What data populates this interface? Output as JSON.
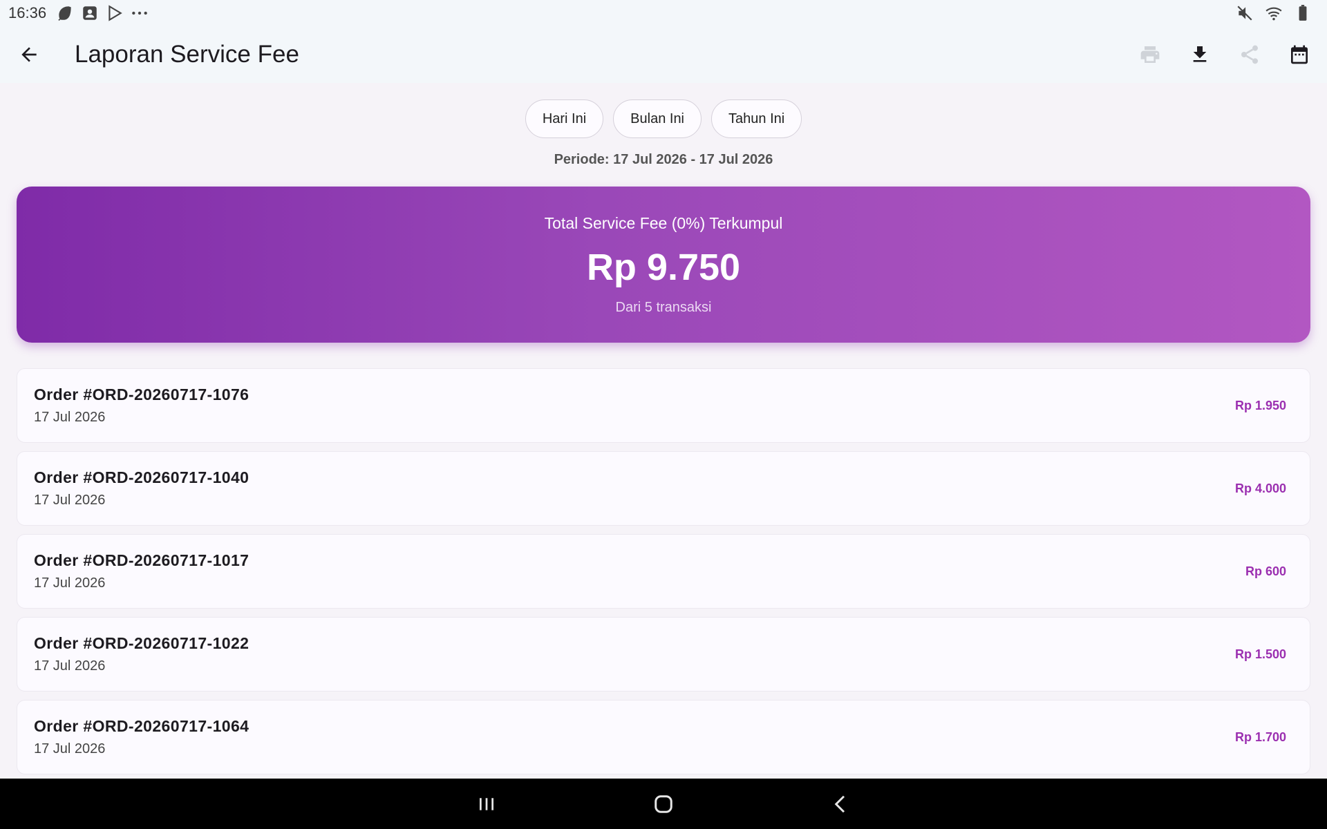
{
  "status_bar": {
    "time": "16:36",
    "left_icons": [
      "leaf-icon",
      "contact-icon",
      "play-icon",
      "more-dots-icon"
    ],
    "right_icons": [
      "mute-icon",
      "wifi-icon",
      "battery-icon"
    ]
  },
  "app_bar": {
    "title": "Laporan Service Fee",
    "actions": [
      "print-icon",
      "download-icon",
      "share-icon",
      "calendar-icon"
    ]
  },
  "filters": {
    "chips": [
      "Hari Ini",
      "Bulan Ini",
      "Tahun Ini"
    ]
  },
  "period": "Periode: 17 Jul 2026 - 17 Jul 2026",
  "summary": {
    "label": "Total Service Fee (0%) Terkumpul",
    "amount": "Rp 9.750",
    "sub": "Dari 5 transaksi"
  },
  "transactions": [
    {
      "order": "Order #ORD-20260717-1076",
      "date": "17 Jul 2026",
      "fee": "Rp 1.950"
    },
    {
      "order": "Order #ORD-20260717-1040",
      "date": "17 Jul 2026",
      "fee": "Rp 4.000"
    },
    {
      "order": "Order #ORD-20260717-1017",
      "date": "17 Jul 2026",
      "fee": "Rp 600"
    },
    {
      "order": "Order #ORD-20260717-1022",
      "date": "17 Jul 2026",
      "fee": "Rp 1.500"
    },
    {
      "order": "Order #ORD-20260717-1064",
      "date": "17 Jul 2026",
      "fee": "Rp 1.700"
    }
  ],
  "colors": {
    "gradient_start": "#7f2ba8",
    "gradient_end": "#b257c2",
    "fee_text": "#9b2fb0"
  },
  "nav_bar": [
    "recent-apps-icon",
    "home-icon",
    "back-nav-icon"
  ]
}
